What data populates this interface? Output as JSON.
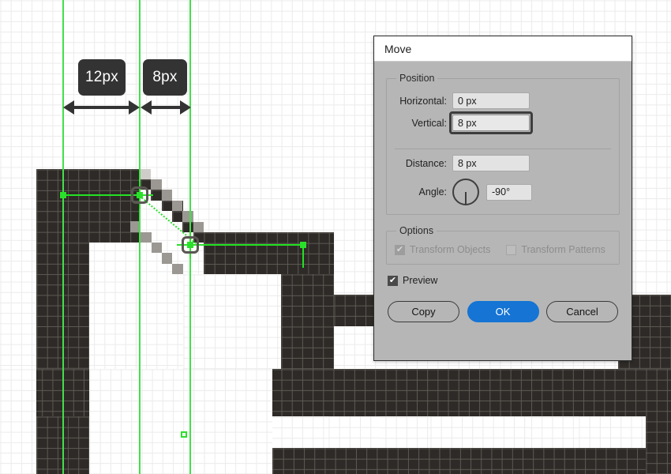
{
  "dialog": {
    "title": "Move",
    "groups": {
      "position": {
        "legend": "Position",
        "horizontal_label": "Horizontal:",
        "horizontal_value": "0 px",
        "vertical_label": "Vertical:",
        "vertical_value": "8 px",
        "distance_label": "Distance:",
        "distance_value": "8 px",
        "angle_label": "Angle:",
        "angle_value": "-90°",
        "angle_dial_icon": "angle-dial-icon"
      },
      "options": {
        "legend": "Options",
        "transform_objects_label": "Transform Objects",
        "transform_patterns_label": "Transform Patterns",
        "checkmark": "✔"
      }
    },
    "preview_label": "Preview",
    "buttons": {
      "copy": "Copy",
      "ok": "OK",
      "cancel": "Cancel"
    },
    "colors": {
      "primary": "#1574d4",
      "dialog_bg": "#b6b6b6",
      "field_bg": "#e3e3e3"
    }
  },
  "canvas": {
    "measurements": [
      {
        "label": "12px"
      },
      {
        "label": "8px"
      }
    ],
    "colors": {
      "guide_green": "#41e048",
      "path_green": "#22e222",
      "shape_dark": "#2e2a27",
      "grid_line": "#ebebeb"
    }
  }
}
